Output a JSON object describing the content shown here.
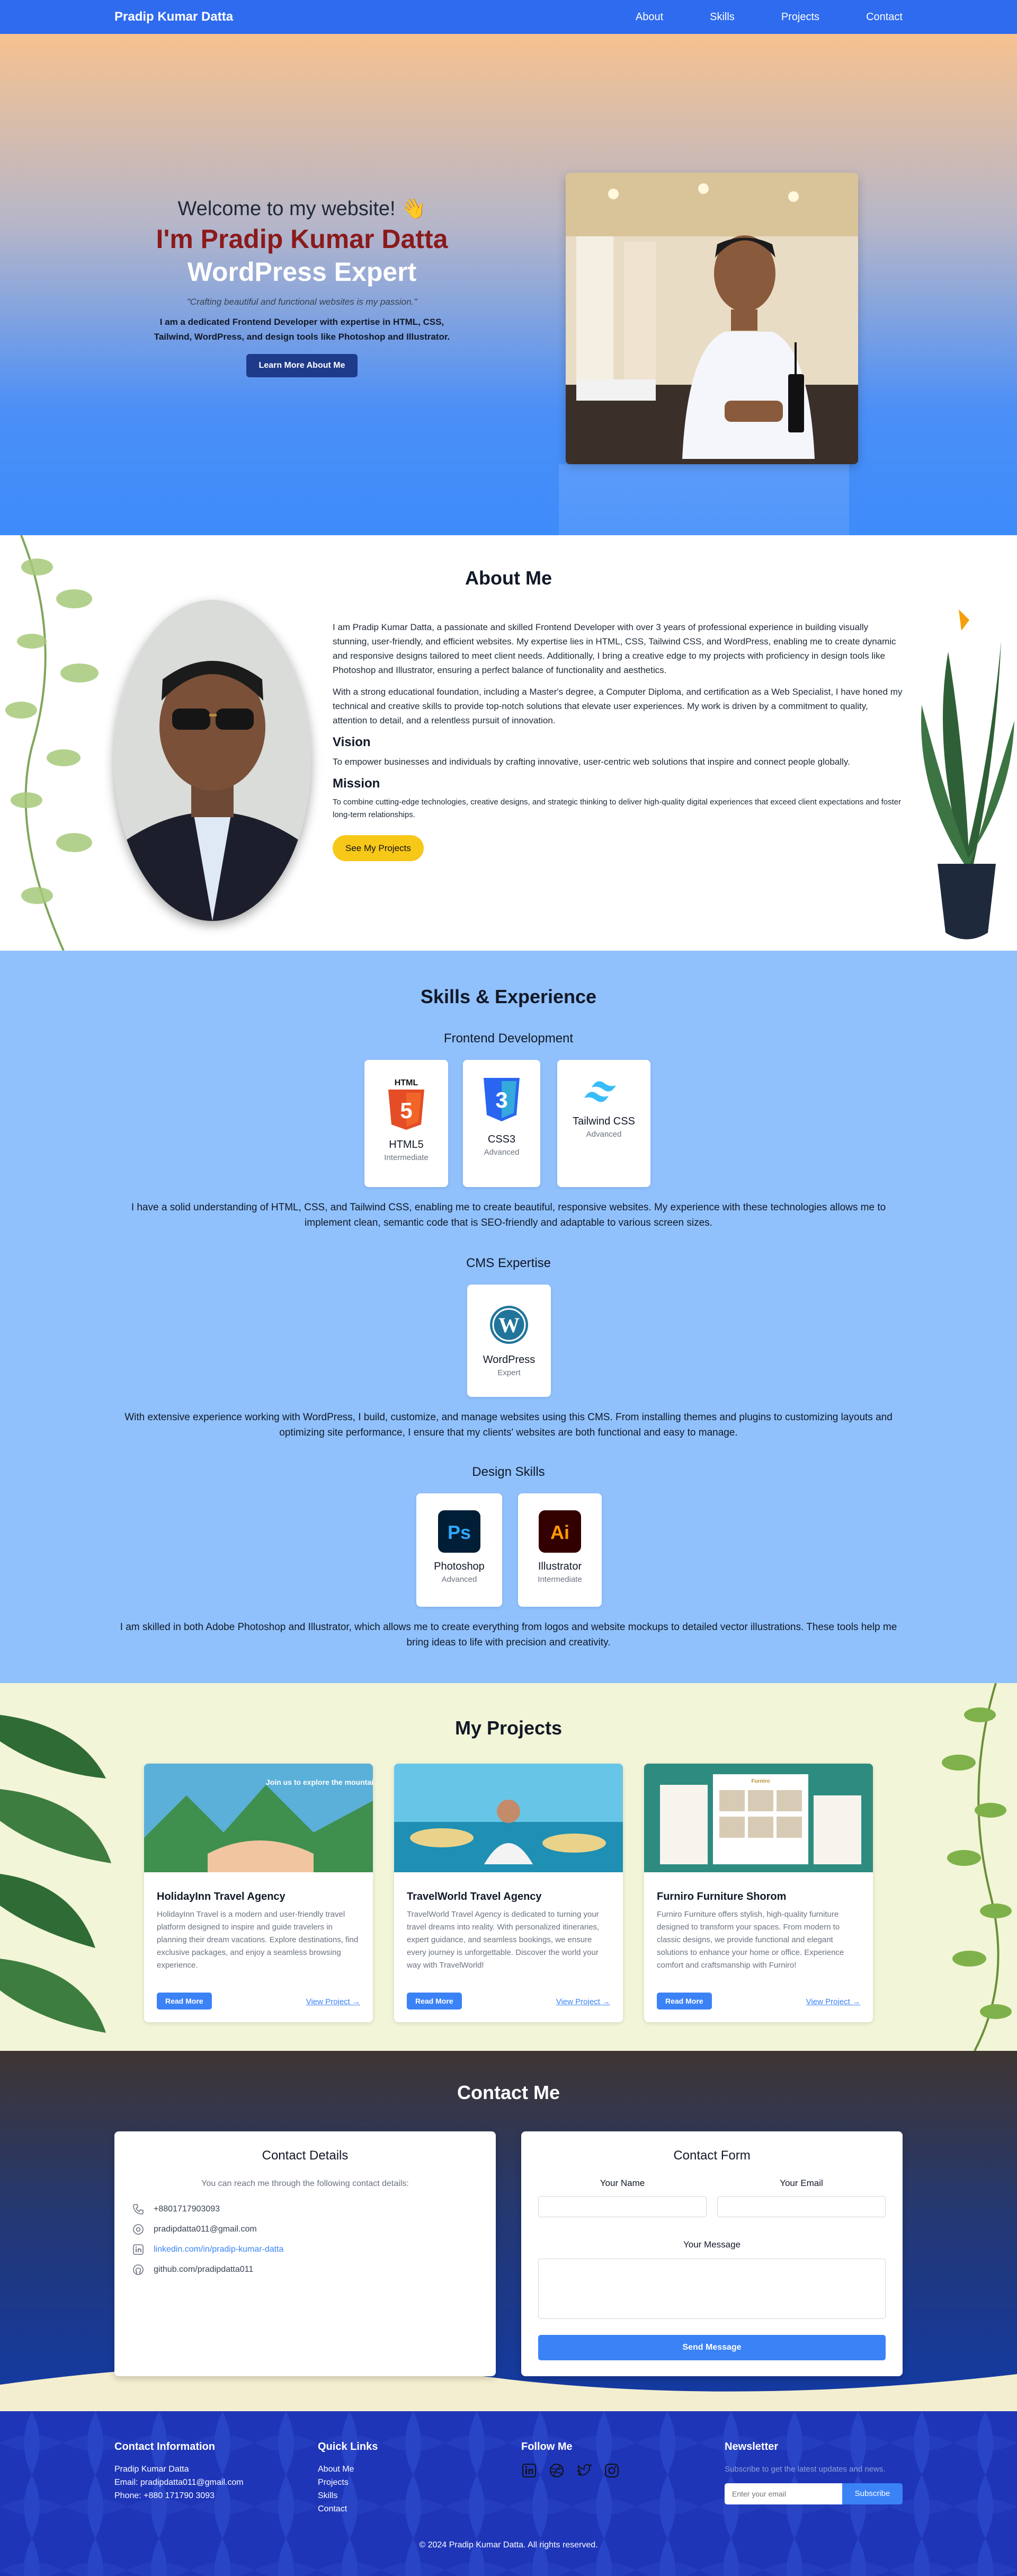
{
  "nav": {
    "brand": "Pradip Kumar Datta",
    "links": [
      "About",
      "Skills",
      "Projects",
      "Contact"
    ]
  },
  "hero": {
    "welcome": "Welcome to my website! 👋",
    "name": "I'm Pradip Kumar Datta",
    "role": "WordPress Expert",
    "quote": "\"Crafting beautiful and functional websites is my passion.\"",
    "description": "I am a dedicated Frontend Developer with expertise in HTML, CSS, Tailwind, WordPress, and design tools like Photoshop and Illustrator.",
    "button": "Learn More About Me"
  },
  "about": {
    "title": "About Me",
    "p1": "I am Pradip Kumar Datta, a passionate and skilled Frontend Developer with over 3 years of professional experience in building visually stunning, user-friendly, and efficient websites. My expertise lies in HTML, CSS, Tailwind CSS, and WordPress, enabling me to create dynamic and responsive designs tailored to meet client needs. Additionally, I bring a creative edge to my projects with proficiency in design tools like Photoshop and Illustrator, ensuring a perfect balance of functionality and aesthetics.",
    "p2": "With a strong educational foundation, including a Master's degree, a Computer Diploma, and certification as a Web Specialist, I have honed my technical and creative skills to provide top-notch solutions that elevate user experiences. My work is driven by a commitment to quality, attention to detail, and a relentless pursuit of innovation.",
    "vision_title": "Vision",
    "vision": "To empower businesses and individuals by crafting innovative, user-centric web solutions that inspire and connect people globally.",
    "mission_title": "Mission",
    "mission": "To combine cutting-edge technologies, creative designs, and strategic thinking to deliver high-quality digital experiences that exceed client expectations and foster long-term relationships.",
    "button": "See My Projects"
  },
  "skills": {
    "title": "Skills & Experience",
    "frontend_title": "Frontend Development",
    "frontend": [
      {
        "name": "HTML5",
        "level": "Intermediate",
        "icon": "html5-icon"
      },
      {
        "name": "CSS3",
        "level": "Advanced",
        "icon": "css3-icon"
      },
      {
        "name": "Tailwind CSS",
        "level": "Advanced",
        "icon": "tailwind-icon"
      }
    ],
    "frontend_text": "I have a solid understanding of HTML, CSS, and Tailwind CSS, enabling me to create beautiful, responsive websites. My experience with these technologies allows me to implement clean, semantic code that is SEO-friendly and adaptable to various screen sizes.",
    "cms_title": "CMS Expertise",
    "cms": [
      {
        "name": "WordPress",
        "level": "Expert",
        "icon": "wordpress-icon"
      }
    ],
    "cms_text": "With extensive experience working with WordPress, I build, customize, and manage websites using this CMS. From installing themes and plugins to customizing layouts and optimizing site performance, I ensure that my clients' websites are both functional and easy to manage.",
    "design_title": "Design Skills",
    "design": [
      {
        "name": "Photoshop",
        "level": "Advanced",
        "icon": "photoshop-icon"
      },
      {
        "name": "Illustrator",
        "level": "Intermediate",
        "icon": "illustrator-icon"
      }
    ],
    "design_text": "I am skilled in both Adobe Photoshop and Illustrator, which allows me to create everything from logos and website mockups to detailed vector illustrations. These tools help me bring ideas to life with precision and creativity.",
    "colors": {
      "html": "#e44d26",
      "css": "#2965f1",
      "tailwind": "#38bdf8",
      "wordpress": "#21759b",
      "ps_bg": "#001e36",
      "ps_fg": "#31a8ff",
      "ai_bg": "#330000",
      "ai_fg": "#ff9a00"
    }
  },
  "projects": {
    "title": "My Projects",
    "items": [
      {
        "title": "HolidayInn Travel Agency",
        "desc": "HolidayInn Travel is a modern and user-friendly travel platform designed to inspire and guide travelers in planning their dream vacations. Explore destinations, find exclusive packages, and enjoy a seamless browsing experience.",
        "btn": "Read More",
        "link": "View Project →"
      },
      {
        "title": "TravelWorld Travel Agency",
        "desc": "TravelWorld Travel Agency is dedicated to turning your travel dreams into reality. With personalized itineraries, expert guidance, and seamless bookings, we ensure every journey is unforgettable. Discover the world your way with TravelWorld!",
        "btn": "Read More",
        "link": "View Project →"
      },
      {
        "title": "Furniro Furniture Shorom",
        "desc": "Furniro Furniture offers stylish, high-quality furniture designed to transform your spaces. From modern to classic designs, we provide functional and elegant solutions to enhance your home or office. Experience comfort and craftsmanship with Furniro!",
        "btn": "Read More",
        "link": "View Project →"
      }
    ],
    "image_text": {
      "holiday_heading": "Join us to explore the mountains",
      "furniro_logo": "Furniro"
    }
  },
  "contact": {
    "title": "Contact Me",
    "details_title": "Contact Details",
    "details_intro": "You can reach me through the following contact details:",
    "phone": "+8801717903093",
    "email": "pradipdatta011@gmail.com",
    "linkedin": "linkedin.com/in/pradip-kumar-datta",
    "github": "github.com/pradipdatta011",
    "form_title": "Contact Form",
    "name_label": "Your Name",
    "email_label": "Your Email",
    "message_label": "Your Message",
    "send": "Send Message"
  },
  "footer": {
    "info_title": "Contact Information",
    "info_name": "Pradip Kumar Datta",
    "info_email": "Email: pradipdatta011@gmail.com",
    "info_phone": "Phone: +880 171790 3093",
    "links_title": "Quick Links",
    "links": [
      "About Me",
      "Projects",
      "Skills",
      "Contact"
    ],
    "follow_title": "Follow Me",
    "newsletter_title": "Newsletter",
    "newsletter_text": "Subscribe to get the latest updates and news.",
    "newsletter_placeholder": "Enter your email",
    "subscribe": "Subscribe",
    "copyright": "© 2024 Pradip Kumar Datta. All rights reserved."
  }
}
